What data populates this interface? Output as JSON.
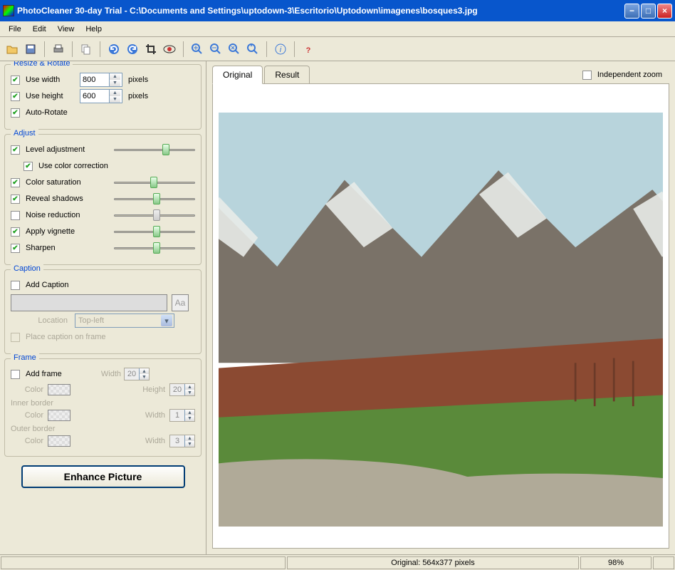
{
  "title": "PhotoCleaner 30-day Trial - C:\\Documents and Settings\\uptodown-3\\Escritorio\\Uptodown\\imagenes\\bosques3.jpg",
  "menu": {
    "file": "File",
    "edit": "Edit",
    "view": "View",
    "help": "Help"
  },
  "groups": {
    "resize": {
      "title": "Resize & Rotate",
      "use_width": "Use width",
      "width_val": "800",
      "pixels": "pixels",
      "use_height": "Use height",
      "height_val": "600",
      "auto_rotate": "Auto-Rotate"
    },
    "adjust": {
      "title": "Adjust",
      "level": "Level adjustment",
      "color_corr": "Use color correction",
      "saturation": "Color saturation",
      "shadows": "Reveal shadows",
      "noise": "Noise reduction",
      "vignette": "Apply vignette",
      "sharpen": "Sharpen"
    },
    "caption": {
      "title": "Caption",
      "add": "Add Caption",
      "aa": "Aa",
      "location_lbl": "Location",
      "location_val": "Top-left",
      "on_frame": "Place caption on frame"
    },
    "frame": {
      "title": "Frame",
      "add": "Add frame",
      "color": "Color",
      "width": "Width",
      "width_val": "20",
      "height": "Height",
      "height_val": "20",
      "inner": "Inner border",
      "inner_w": "1",
      "outer": "Outer border",
      "outer_w": "3"
    }
  },
  "enhance": "Enhance Picture",
  "tabs": {
    "original": "Original",
    "result": "Result"
  },
  "indep_zoom": "Independent zoom",
  "status": {
    "info": "Original: 564x377 pixels",
    "zoom": "98%"
  }
}
